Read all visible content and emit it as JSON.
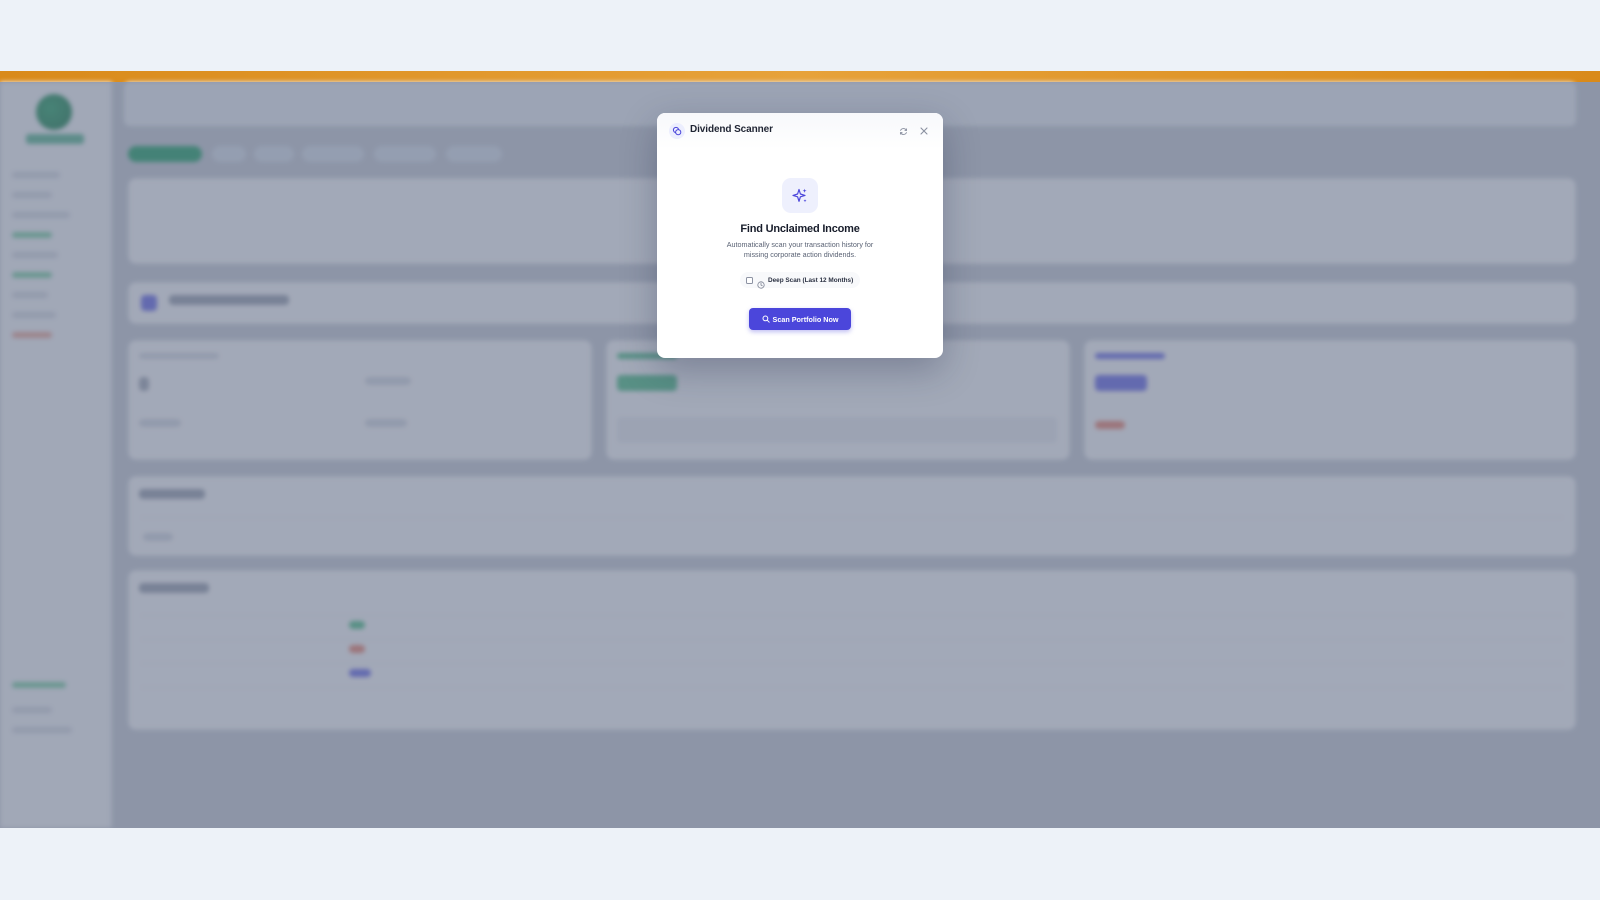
{
  "modal": {
    "title": "Dividend Scanner",
    "header_icon": "coins-icon",
    "refresh_icon": "refresh-icon",
    "close_icon": "close-icon",
    "hero_icon": "sparkles-icon",
    "hero_title": "Find Unclaimed Income",
    "hero_description": "Automatically scan your transaction history for missing corporate action dividends.",
    "deep_scan": {
      "label": "Deep Scan (Last 12 Months)",
      "checked": false,
      "icon": "clock-icon"
    },
    "scan_button": {
      "label": "Scan Portfolio Now",
      "icon": "search-icon"
    }
  },
  "colors": {
    "accent_bar": "#e09a2c",
    "primary": "#4b46db",
    "overlay": "rgba(92,104,130,0.55)",
    "page_background": "#edf2f8"
  }
}
